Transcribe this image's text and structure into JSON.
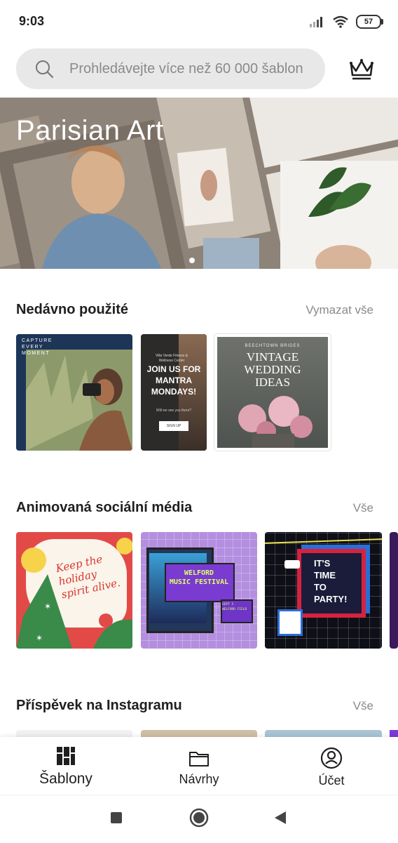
{
  "status": {
    "time": "9:03",
    "battery": "57"
  },
  "search": {
    "placeholder": "Prohledávejte více než 60 000 šablon",
    "icon": "search-icon"
  },
  "premium": {
    "icon": "crown-icon"
  },
  "hero": {
    "title": "Parisian Art",
    "slides": 2,
    "active_slide": 1
  },
  "recent": {
    "title": "Nedávno použité",
    "action": "Vymazat vše",
    "items": [
      {
        "lines": [
          "CAPTURE",
          "EVERY",
          "MOMENT"
        ]
      },
      {
        "small": "Villa Verde Fitness & Wellness Center",
        "headline": [
          "JOIN US FOR",
          "MANTRA",
          "MONDAYS!"
        ],
        "sub": "Will we see you there?",
        "button": "SIGN UP"
      },
      {
        "brand": "BEECHTOWN BRIDES",
        "headline": [
          "VINTAGE",
          "WEDDING",
          "IDEAS"
        ]
      }
    ]
  },
  "animated": {
    "title": "Animovaná sociální média",
    "action": "Vše",
    "items": [
      {
        "headline": [
          "Keep the",
          "holiday",
          "spirit alive."
        ]
      },
      {
        "headline": [
          "WELFORD",
          "MUSIC FESTIVAL"
        ],
        "date": [
          "SEPT 5",
          "WELFORD FIELD"
        ]
      },
      {
        "headline": [
          "IT'S",
          "TIME",
          "TO",
          "PARTY!"
        ]
      }
    ]
  },
  "instagram": {
    "title": "Příspěvek na Instagramu",
    "action": "Vše"
  },
  "nav": {
    "templates": "Šablony",
    "designs": "Návrhy",
    "account": "Účet"
  },
  "colors": {
    "accent": "#1f1f1f",
    "muted": "#8a8a8a",
    "search_bg": "#e8e8e8"
  }
}
